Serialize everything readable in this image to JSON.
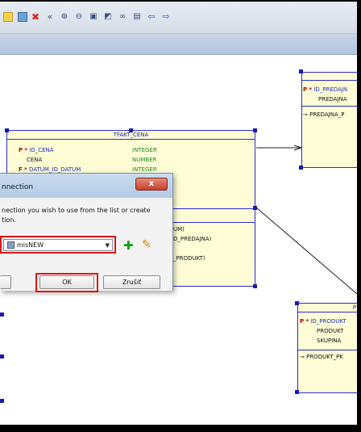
{
  "toolbar": {
    "icons": [
      "folder-icon",
      "image-icon",
      "delete-icon",
      "rewind-icon",
      "zoom-in-icon",
      "zoom-out-icon",
      "fit-icon",
      "layout-icon",
      "binoculars-icon",
      "properties-icon",
      "back-arrow-icon",
      "forward-arrow-icon"
    ]
  },
  "tables": {
    "tfakt": {
      "title": "TFAKT_CENA",
      "rows": [
        {
          "marker": "P",
          "star": "*",
          "name": "ID_CENA",
          "type": "INTEGER"
        },
        {
          "marker": "",
          "star": "",
          "name": "CENA",
          "type": "NUMBER"
        },
        {
          "marker": "F",
          "star": "*",
          "name": "DATUM_ID_DATUM",
          "type": "INTEGER"
        }
      ],
      "lower_lines": [
        "UM)",
        "D_PREDAJNA)",
        "_PRODUKT)"
      ]
    },
    "predajna": {
      "rows": [
        {
          "marker": "P",
          "star": "*",
          "name": "ID_PREDAJN"
        },
        {
          "marker": "",
          "star": "",
          "name": "PREDAJNA"
        }
      ],
      "key": "PREDAJNA_P"
    },
    "produkt": {
      "title": "P",
      "rows": [
        {
          "marker": "P",
          "star": "*",
          "name": "ID_PRODUKT"
        },
        {
          "marker": "",
          "star": "",
          "name": "PRODUKT"
        },
        {
          "marker": "",
          "star": "",
          "name": "SKUPINA"
        }
      ],
      "key": "PRODUKT_PK"
    }
  },
  "dialog": {
    "title": "nnection",
    "message_line1": "nection you wish to use from the list or create",
    "message_line2": "tion.",
    "connection_value": "misNEW",
    "ok_label": "OK",
    "cancel_label": "Zrušiť",
    "close_symbol": "x"
  },
  "colors": {
    "table_fill": "#fefdd6",
    "table_border": "#2b2bd0",
    "highlight": "#e01515",
    "column_type": "#1d8a1d"
  }
}
